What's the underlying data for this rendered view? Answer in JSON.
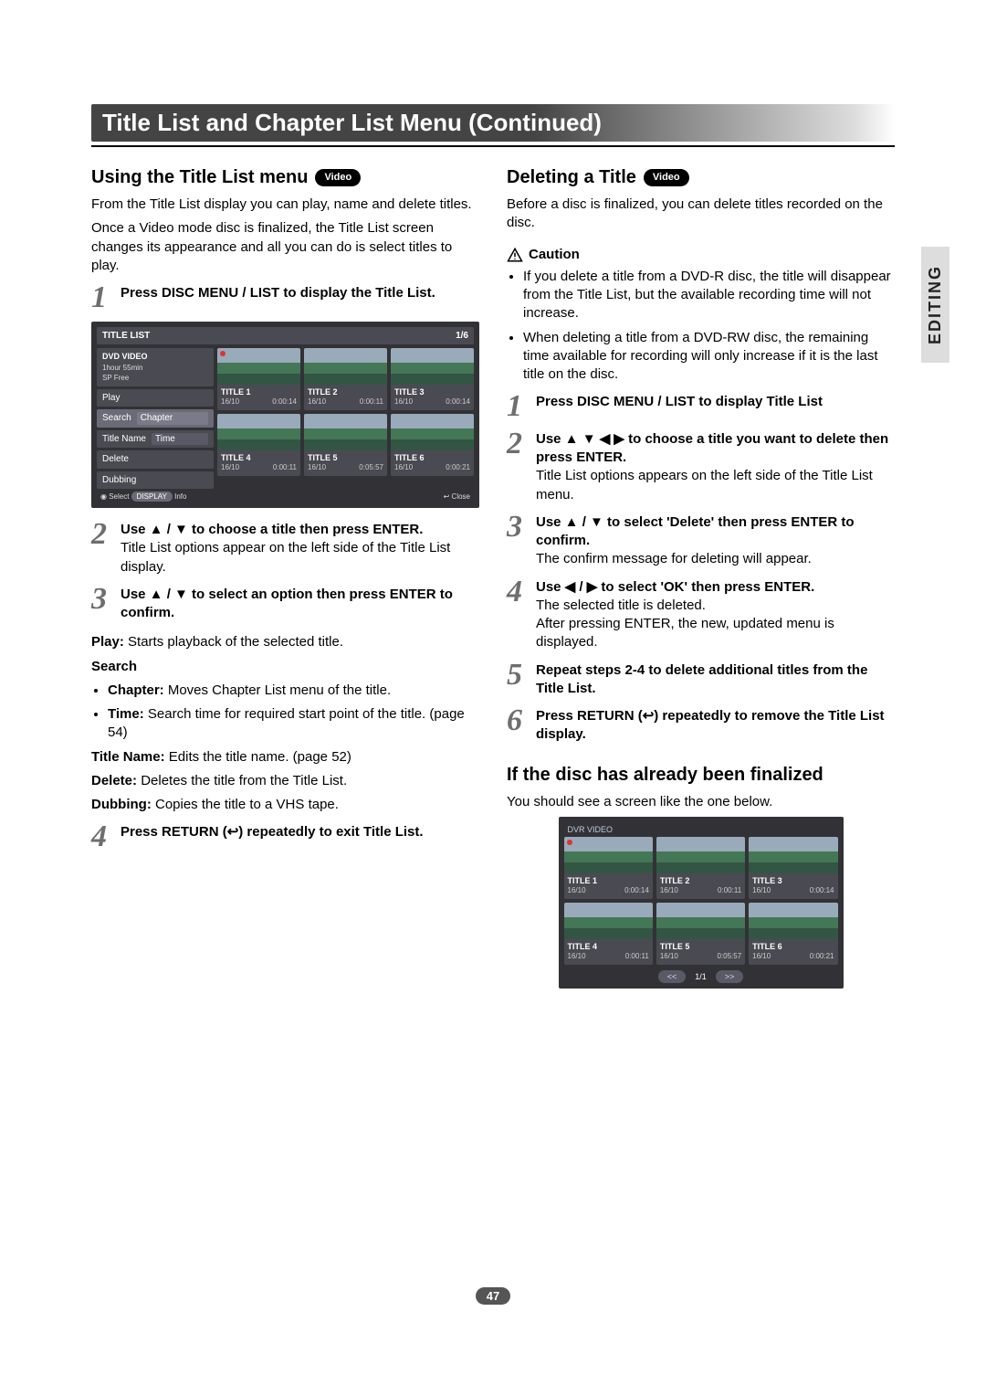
{
  "sideTab": "EDITING",
  "titleBar": "Title List and Chapter List Menu (Continued)",
  "videoPill": "Video",
  "pageNumber": "47",
  "left": {
    "heading": "Using the Title List menu",
    "intro1": "From the Title List display you can play, name and delete titles.",
    "intro2": "Once a Video mode disc is finalized, the Title List screen changes its appearance and all you can do is select titles to play.",
    "steps": {
      "s1": "Press DISC MENU / LIST to display the Title List.",
      "s2b": "Use ▲ / ▼ to choose a title then press ENTER.",
      "s2t": "Title List options appear on the left side of the Title List display.",
      "s3": "Use ▲ / ▼ to select an option then press ENTER to confirm.",
      "playLabel": "Play:",
      "playText": " Starts playback of the selected title.",
      "searchHead": "Search",
      "searchChapterB": "Chapter:",
      "searchChapterT": " Moves Chapter List menu of the title.",
      "searchTimeB": "Time:",
      "searchTimeT": " Search time for required start point of the title. (page 54)",
      "titleNameB": "Title Name:",
      "titleNameT": " Edits the title name. (page 52)",
      "deleteB": "Delete:",
      "deleteT": " Deletes the title from the Title List.",
      "dubbingB": "Dubbing:",
      "dubbingT": " Copies the title to a VHS tape.",
      "s4": "Press RETURN (↩) repeatedly to exit Title List."
    },
    "osd": {
      "header": "TITLE LIST",
      "pager": "1/6",
      "panelTitle": "DVD VIDEO",
      "panelLine1": "1hour 55min",
      "panelLine2": "SP  Free",
      "menu": {
        "play": "Play",
        "search": "Search",
        "chapter": "Chapter",
        "titleName": "Title Name",
        "time": "Time",
        "delete": "Delete",
        "dubbing": "Dubbing"
      },
      "footerSelect": "Select",
      "footerDisplay": "DISPLAY",
      "footerInfo": "Info",
      "footerClose": "Close",
      "titles": [
        {
          "name": "TITLE 1",
          "date": "16/10",
          "dur": "0:00:14"
        },
        {
          "name": "TITLE 2",
          "date": "16/10",
          "dur": "0:00:11"
        },
        {
          "name": "TITLE 3",
          "date": "16/10",
          "dur": "0:00:14"
        },
        {
          "name": "TITLE 4",
          "date": "16/10",
          "dur": "0:00:11"
        },
        {
          "name": "TITLE 5",
          "date": "16/10",
          "dur": "0:05:57"
        },
        {
          "name": "TITLE 6",
          "date": "16/10",
          "dur": "0:00:21"
        }
      ]
    }
  },
  "right": {
    "heading": "Deleting a Title",
    "intro": "Before a disc is finalized, you can delete titles recorded on the disc.",
    "cautionHead": "Caution",
    "caution1": "If you delete a title from a DVD-R disc, the title will disappear from the Title List, but the available recording time will not increase.",
    "caution2": "When deleting a title from a DVD-RW disc, the remaining time available for recording will only increase if it is the last title on the disc.",
    "steps": {
      "s1": "Press DISC MENU / LIST to display Title List",
      "s2b": "Use ▲ ▼ ◀ ▶ to choose a title you want to delete then press ENTER.",
      "s2t": "Title List options appears on the left side of the Title List menu.",
      "s3b": "Use ▲ / ▼ to select 'Delete' then press ENTER to confirm.",
      "s3t": "The confirm message for deleting will appear.",
      "s4b": "Use ◀ / ▶ to select 'OK' then press ENTER.",
      "s4t1": "The selected title is deleted.",
      "s4t2": "After pressing ENTER, the new, updated menu is displayed.",
      "s5": "Repeat steps 2-4 to delete additional titles from the Title List.",
      "s6": "Press RETURN (↩) repeatedly to remove the Title List display."
    },
    "finalHeading": "If the disc has already been finalized",
    "finalText": "You should see a screen like the one below.",
    "osd": {
      "top": "DVR VIDEO",
      "pager": "1/1",
      "prev": "<<",
      "next": ">>",
      "titles": [
        {
          "name": "TITLE 1",
          "date": "16/10",
          "dur": "0:00:14"
        },
        {
          "name": "TITLE 2",
          "date": "16/10",
          "dur": "0:00:11"
        },
        {
          "name": "TITLE 3",
          "date": "16/10",
          "dur": "0:00:14"
        },
        {
          "name": "TITLE 4",
          "date": "16/10",
          "dur": "0:00:11"
        },
        {
          "name": "TITLE 5",
          "date": "16/10",
          "dur": "0:05:57"
        },
        {
          "name": "TITLE 6",
          "date": "16/10",
          "dur": "0:00:21"
        }
      ]
    }
  }
}
